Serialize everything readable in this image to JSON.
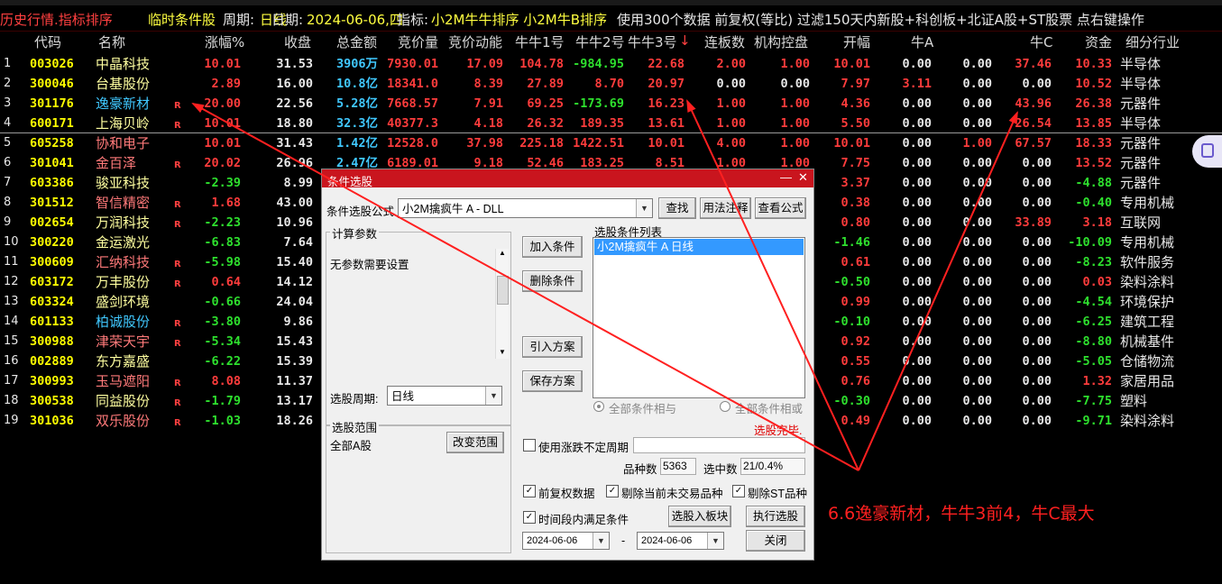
{
  "status_bar": {
    "mode": "历史行情.指标排序",
    "condition": "临时条件股",
    "period_label": "周期:",
    "period_value": "日线",
    "date_label": "日期:",
    "date_value": "2024-06-06,四",
    "indicator_label": "指标:",
    "indicator_value": "小2M牛牛排序 小2M牛B排序",
    "info": "使用300个数据 前复权(等比) 过滤150天内新股+科创板+北证A股+ST股票 点右键操作"
  },
  "columns": [
    "代码",
    "名称",
    "涨幅%",
    "收盘",
    "总金额",
    "竞价量",
    "竞价动能",
    "牛牛1号",
    "牛牛2号",
    "牛牛3号",
    "连板数",
    "机构控盘",
    "开幅",
    "牛A",
    "",
    "牛C",
    "资金",
    "细分行业"
  ],
  "sort_marker": "↓",
  "rows": [
    {
      "idx": "1",
      "code": "003026",
      "name": "中晶科技",
      "r": "",
      "chg": "10.01",
      "close": "31.53",
      "amt": "3906万",
      "auc": "7930.01",
      "auce": "17.09",
      "n1": "104.78",
      "n2": "-984.95",
      "n3": "22.68",
      "lb": "2.00",
      "jg": "1.00",
      "open": "10.01",
      "na": "0.00",
      "nb": "0.00",
      "nc": "37.46",
      "fund": "10.33",
      "ind": "半导体"
    },
    {
      "idx": "2",
      "code": "300046",
      "name": "台基股份",
      "r": "",
      "chg": "2.89",
      "close": "16.00",
      "amt": "10.8亿",
      "auc": "18341.0",
      "auce": "8.39",
      "n1": "27.89",
      "n2": "8.70",
      "n3": "20.97",
      "lb": "0.00",
      "jg": "0.00",
      "open": "7.97",
      "na": "3.11",
      "nb": "0.00",
      "nc": "0.00",
      "fund": "10.52",
      "ind": "半导体"
    },
    {
      "idx": "3",
      "code": "301176",
      "name": "逸豪新材",
      "r": "R",
      "chg": "20.00",
      "close": "22.56",
      "amt": "5.28亿",
      "auc": "7668.57",
      "auce": "7.91",
      "n1": "69.25",
      "n2": "-173.69",
      "n3": "16.23",
      "lb": "1.00",
      "jg": "1.00",
      "open": "4.36",
      "na": "0.00",
      "nb": "0.00",
      "nc": "43.96",
      "fund": "26.38",
      "ind": "元器件"
    },
    {
      "idx": "4",
      "code": "600171",
      "name": "上海贝岭",
      "r": "R",
      "chg": "10.01",
      "close": "18.80",
      "amt": "32.3亿",
      "auc": "40377.3",
      "auce": "4.18",
      "n1": "26.32",
      "n2": "189.35",
      "n3": "13.61",
      "lb": "1.00",
      "jg": "1.00",
      "open": "5.50",
      "na": "0.00",
      "nb": "0.00",
      "nc": "26.54",
      "fund": "13.85",
      "ind": "半导体"
    },
    {
      "idx": "5",
      "code": "605258",
      "name": "协和电子",
      "r": "",
      "chg": "10.01",
      "close": "31.43",
      "amt": "1.42亿",
      "auc": "12528.0",
      "auce": "37.98",
      "n1": "225.18",
      "n2": "1422.51",
      "n3": "10.01",
      "lb": "4.00",
      "jg": "1.00",
      "open": "10.01",
      "na": "0.00",
      "nb": "1.00",
      "nc": "67.57",
      "fund": "18.33",
      "ind": "元器件"
    },
    {
      "idx": "6",
      "code": "301041",
      "name": "金百泽",
      "r": "R",
      "chg": "20.02",
      "close": "26.96",
      "amt": "2.47亿",
      "auc": "6189.01",
      "auce": "9.18",
      "n1": "52.46",
      "n2": "183.25",
      "n3": "8.51",
      "lb": "1.00",
      "jg": "1.00",
      "open": "7.75",
      "na": "0.00",
      "nb": "0.00",
      "nc": "0.00",
      "fund": "13.52",
      "ind": "元器件"
    },
    {
      "idx": "7",
      "code": "603386",
      "name": "骏亚科技",
      "r": "",
      "chg": "-2.39",
      "close": "8.99",
      "amt": "",
      "auc": "",
      "auce": "",
      "n1": "",
      "n2": "",
      "n3": "",
      "lb": "",
      "jg": "",
      "open": "3.37",
      "na": "0.00",
      "nb": "0.00",
      "nc": "0.00",
      "fund": "-4.88",
      "ind": "元器件"
    },
    {
      "idx": "8",
      "code": "301512",
      "name": "智信精密",
      "r": "R",
      "chg": "1.68",
      "close": "43.00",
      "amt": "",
      "auc": "",
      "auce": "",
      "n1": "",
      "n2": "",
      "n3": "",
      "lb": "",
      "jg": "",
      "open": "0.38",
      "na": "0.00",
      "nb": "0.00",
      "nc": "0.00",
      "fund": "-0.40",
      "ind": "专用机械"
    },
    {
      "idx": "9",
      "code": "002654",
      "name": "万润科技",
      "r": "R",
      "chg": "-2.23",
      "close": "10.96",
      "amt": "",
      "auc": "",
      "auce": "",
      "n1": "",
      "n2": "",
      "n3": "",
      "lb": "",
      "jg": "",
      "open": "0.80",
      "na": "0.00",
      "nb": "0.00",
      "nc": "33.89",
      "fund": "3.18",
      "ind": "互联网"
    },
    {
      "idx": "10",
      "code": "300220",
      "name": "金运激光",
      "r": "",
      "chg": "-6.83",
      "close": "7.64",
      "amt": "",
      "auc": "",
      "auce": "",
      "n1": "",
      "n2": "",
      "n3": "",
      "lb": "",
      "jg": "",
      "open": "-1.46",
      "na": "0.00",
      "nb": "0.00",
      "nc": "0.00",
      "fund": "-10.09",
      "ind": "专用机械"
    },
    {
      "idx": "11",
      "code": "300609",
      "name": "汇纳科技",
      "r": "R",
      "chg": "-5.98",
      "close": "15.40",
      "amt": "",
      "auc": "",
      "auce": "",
      "n1": "",
      "n2": "",
      "n3": "",
      "lb": "",
      "jg": "",
      "open": "0.61",
      "na": "0.00",
      "nb": "0.00",
      "nc": "0.00",
      "fund": "-8.23",
      "ind": "软件服务"
    },
    {
      "idx": "12",
      "code": "603172",
      "name": "万丰股份",
      "r": "R",
      "chg": "0.64",
      "close": "14.12",
      "amt": "",
      "auc": "",
      "auce": "",
      "n1": "",
      "n2": "",
      "n3": "",
      "lb": "",
      "jg": "",
      "open": "-0.50",
      "na": "0.00",
      "nb": "0.00",
      "nc": "0.00",
      "fund": "0.03",
      "ind": "染料涂料"
    },
    {
      "idx": "13",
      "code": "603324",
      "name": "盛剑环境",
      "r": "",
      "chg": "-0.66",
      "close": "24.04",
      "amt": "",
      "auc": "",
      "auce": "",
      "n1": "",
      "n2": "",
      "n3": "",
      "lb": "",
      "jg": "",
      "open": "0.99",
      "na": "0.00",
      "nb": "0.00",
      "nc": "0.00",
      "fund": "-4.54",
      "ind": "环境保护"
    },
    {
      "idx": "14",
      "code": "601133",
      "name": "柏诚股份",
      "r": "R",
      "chg": "-3.80",
      "close": "9.86",
      "amt": "",
      "auc": "",
      "auce": "",
      "n1": "",
      "n2": "",
      "n3": "",
      "lb": "",
      "jg": "",
      "open": "-0.10",
      "na": "0.00",
      "nb": "0.00",
      "nc": "0.00",
      "fund": "-6.25",
      "ind": "建筑工程"
    },
    {
      "idx": "15",
      "code": "300988",
      "name": "津荣天宇",
      "r": "R",
      "chg": "-5.34",
      "close": "15.43",
      "amt": "",
      "auc": "",
      "auce": "",
      "n1": "",
      "n2": "",
      "n3": "",
      "lb": "",
      "jg": "",
      "open": "0.92",
      "na": "0.00",
      "nb": "0.00",
      "nc": "0.00",
      "fund": "-8.80",
      "ind": "机械基件"
    },
    {
      "idx": "16",
      "code": "002889",
      "name": "东方嘉盛",
      "r": "",
      "chg": "-6.22",
      "close": "15.39",
      "amt": "",
      "auc": "",
      "auce": "",
      "n1": "",
      "n2": "",
      "n3": "",
      "lb": "",
      "jg": "",
      "open": "0.55",
      "na": "0.00",
      "nb": "0.00",
      "nc": "0.00",
      "fund": "-5.05",
      "ind": "仓储物流"
    },
    {
      "idx": "17",
      "code": "300993",
      "name": "玉马遮阳",
      "r": "R",
      "chg": "8.08",
      "close": "11.37",
      "amt": "",
      "auc": "",
      "auce": "",
      "n1": "",
      "n2": "",
      "n3": "",
      "lb": "",
      "jg": "",
      "open": "0.76",
      "na": "0.00",
      "nb": "0.00",
      "nc": "0.00",
      "fund": "1.32",
      "ind": "家居用品"
    },
    {
      "idx": "18",
      "code": "300538",
      "name": "同益股份",
      "r": "R",
      "chg": "-1.79",
      "close": "13.17",
      "amt": "",
      "auc": "",
      "auce": "",
      "n1": "",
      "n2": "",
      "n3": "",
      "lb": "",
      "jg": "",
      "open": "-0.30",
      "na": "0.00",
      "nb": "0.00",
      "nc": "0.00",
      "fund": "-7.75",
      "ind": "塑料"
    },
    {
      "idx": "19",
      "code": "301036",
      "name": "双乐股份",
      "r": "R",
      "chg": "-1.03",
      "close": "18.26",
      "amt": "",
      "auc": "",
      "auce": "",
      "n1": "",
      "n2": "",
      "n3": "",
      "lb": "",
      "jg": "",
      "open": "0.49",
      "na": "0.00",
      "nb": "0.00",
      "nc": "0.00",
      "fund": "-9.71",
      "ind": "染料涂料"
    }
  ],
  "dialog": {
    "title": "条件选股",
    "formula_label": "条件选股公式",
    "formula_value": "小2M擒疯牛 A  -  DLL",
    "btn_find": "查找",
    "btn_usage": "用法注释",
    "btn_view": "查看公式",
    "params_group": "计算参数",
    "params_text": "无参数需要设置",
    "btn_add": "加入条件",
    "btn_delete": "删除条件",
    "btn_import": "引入方案",
    "btn_save": "保存方案",
    "cond_list_label": "选股条件列表",
    "cond_list_item": "小2M擒疯牛 A  日线",
    "period_label": "选股周期:",
    "period_value": "日线",
    "radio_and": "全部条件相与",
    "radio_or": "全部条件相或",
    "done_text": "选股完毕.",
    "range_group": "选股范围",
    "range_value": "全部A股",
    "btn_range": "改变范围",
    "chk_uncertain": "使用涨跌不定周期",
    "count_label": "品种数",
    "count_value": "5363",
    "selected_label": "选中数",
    "selected_value": "21/0.4%",
    "chk_fq": "前复权数据",
    "chk_remove_untraded": "剔除当前未交易品种",
    "chk_remove_st": "剔除ST品种",
    "chk_period_cond": "时间段内满足条件",
    "btn_to_block": "选股入板块",
    "btn_execute": "执行选股",
    "date_from": "2024-06-06",
    "date_dash": "-",
    "date_to": "2024-06-06",
    "btn_close": "关闭"
  },
  "annotation": "6.6逸豪新材，牛牛3前4，牛C最大",
  "colors": {
    "up": "#ff3c3c",
    "down": "#2ee02e",
    "code": "#ffff00",
    "amount": "#40c8ff",
    "accent": "#c9151e"
  }
}
